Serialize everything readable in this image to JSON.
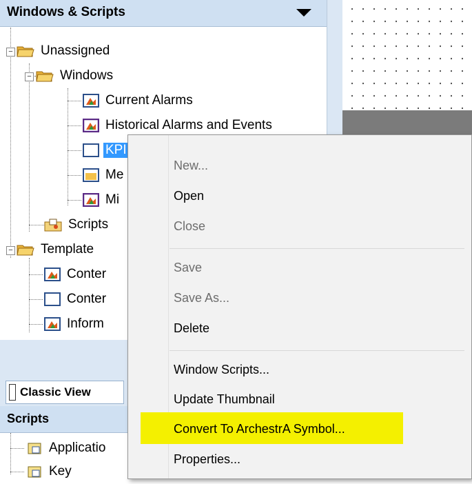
{
  "windows_panel": {
    "title": "Windows & Scripts",
    "tree": [
      {
        "label": "Unassigned"
      },
      {
        "label": "Windows"
      },
      {
        "label": "Current Alarms"
      },
      {
        "label": "Historical Alarms and Events"
      },
      {
        "label": "KPI"
      },
      {
        "label": "Me"
      },
      {
        "label": "Mi"
      },
      {
        "label": "Scripts"
      },
      {
        "label": "Template"
      },
      {
        "label": "Conter"
      },
      {
        "label": "Conter"
      },
      {
        "label": "Inform"
      }
    ]
  },
  "classic_view": {
    "label": "Classic View"
  },
  "scripts_panel": {
    "title": "Scripts",
    "items": [
      {
        "label": "Applicatio"
      },
      {
        "label": "Key"
      }
    ]
  },
  "context_menu": {
    "items": [
      {
        "label": "New...",
        "enabled": false
      },
      {
        "label": "Open",
        "enabled": true
      },
      {
        "label": "Close",
        "enabled": false
      },
      {
        "label": "Save",
        "enabled": false
      },
      {
        "label": "Save As...",
        "enabled": false
      },
      {
        "label": "Delete",
        "enabled": true
      },
      {
        "label": "Window Scripts...",
        "enabled": true
      },
      {
        "label": "Update Thumbnail",
        "enabled": true
      },
      {
        "label": "Convert To ArchestrA Symbol...",
        "enabled": true,
        "highlighted": true,
        "highlight_color": "#f4f000"
      },
      {
        "label": "Properties...",
        "enabled": true
      }
    ]
  },
  "colors": {
    "selection": "#3399ff",
    "panel_header": "#cfe0f2",
    "highlight": "#f4f000"
  }
}
